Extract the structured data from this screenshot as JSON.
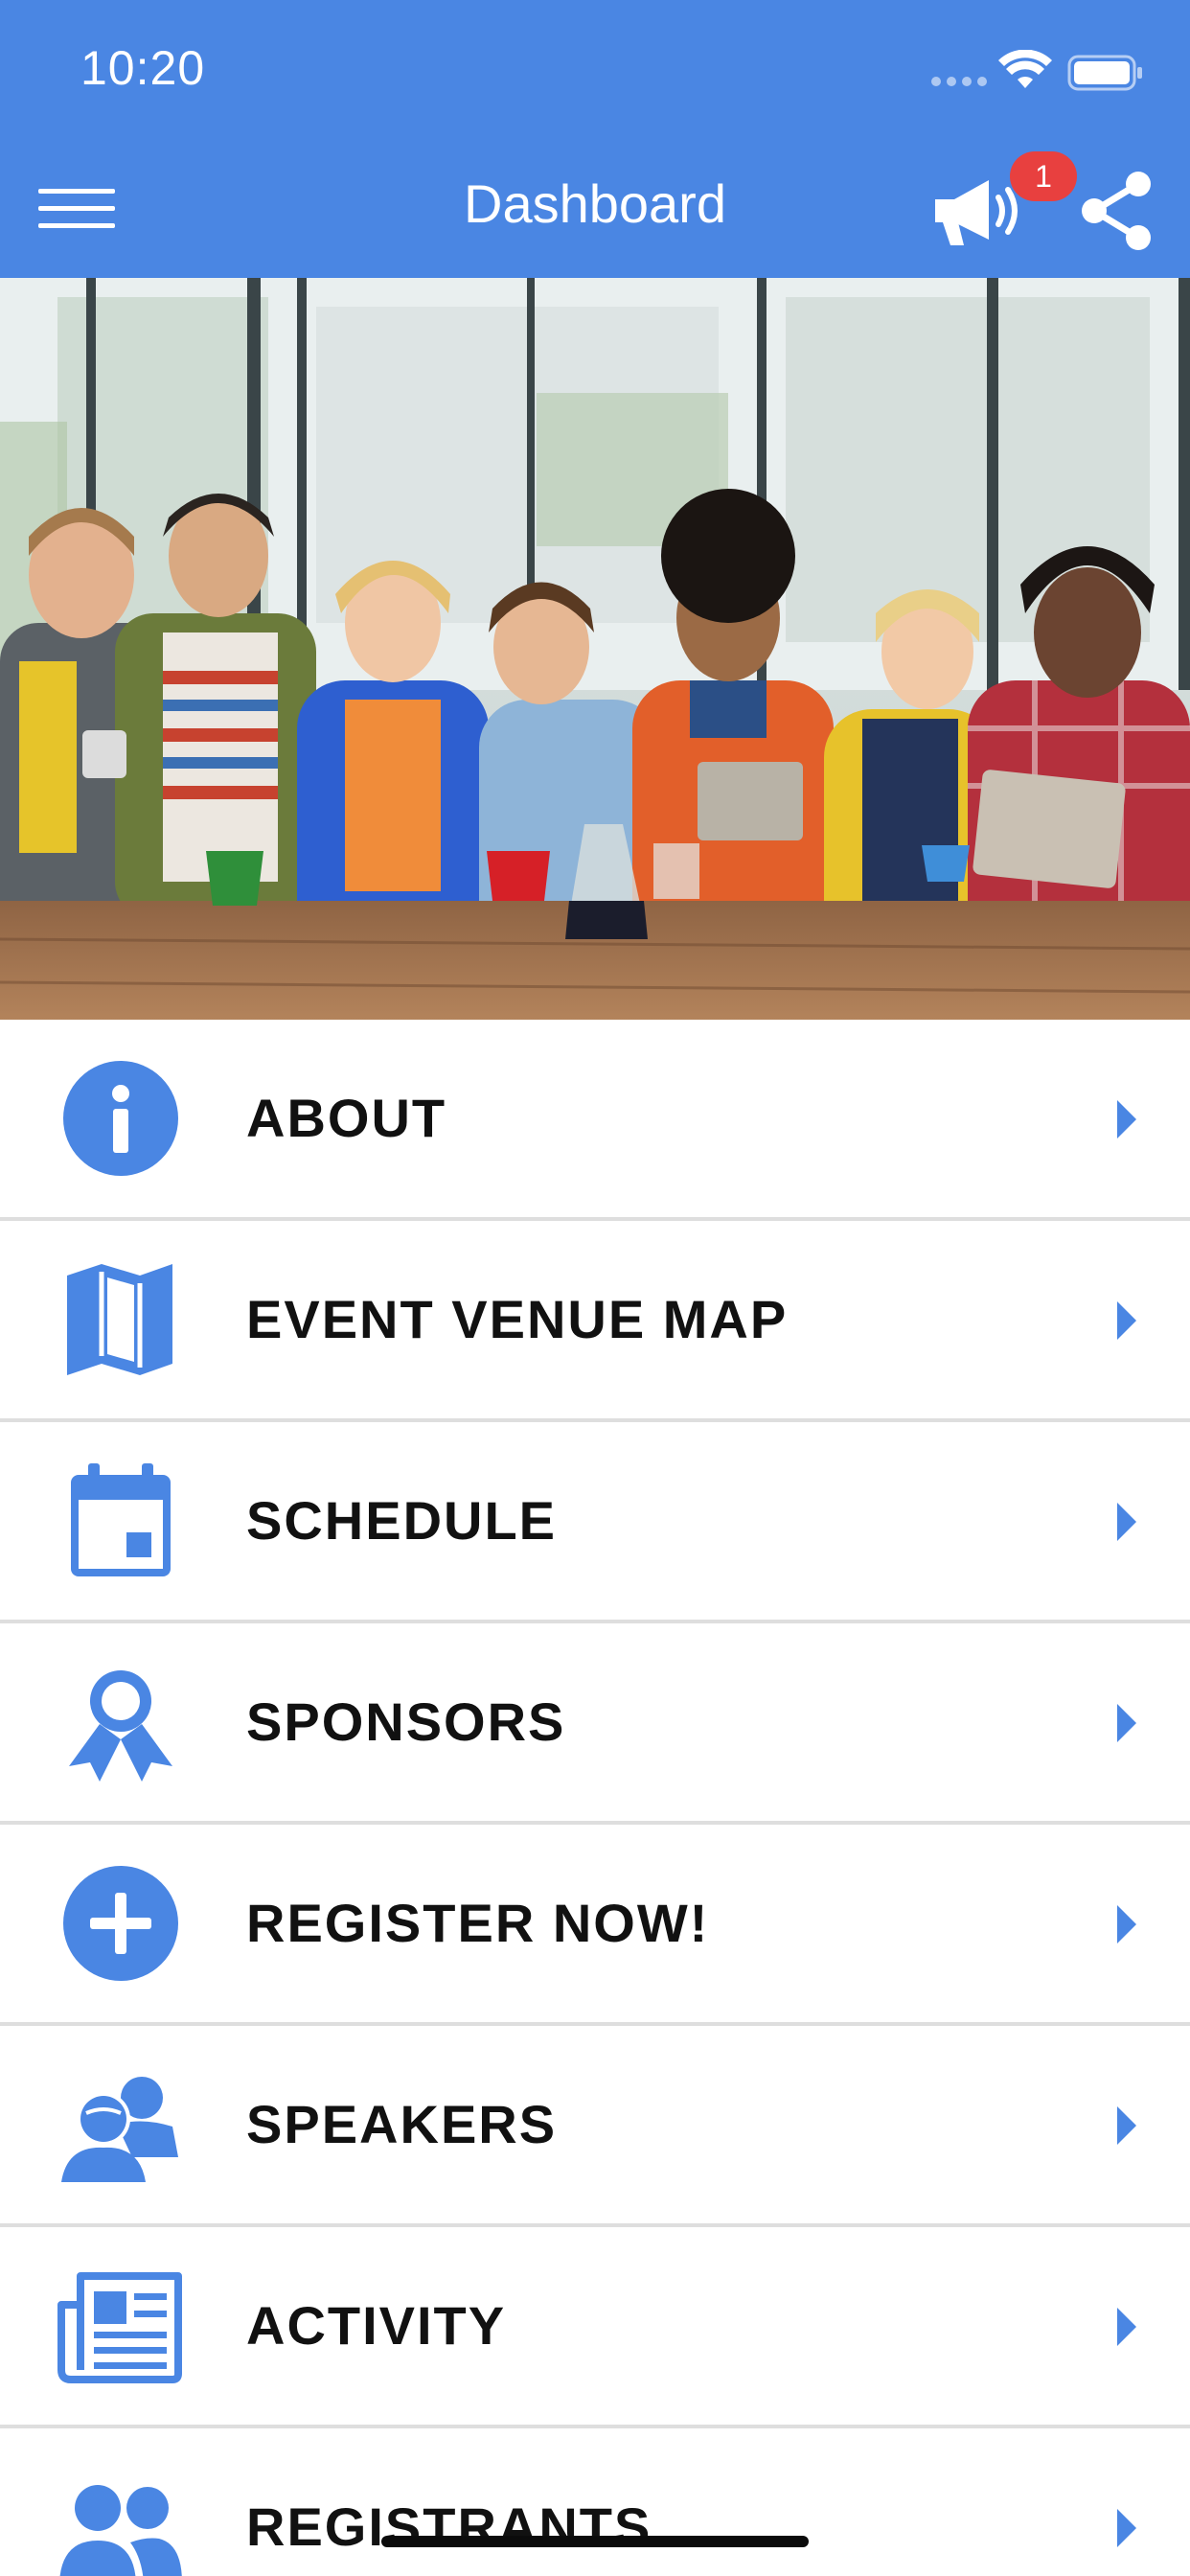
{
  "status_bar": {
    "time": "10:20"
  },
  "nav": {
    "title": "Dashboard",
    "notification_count": "1",
    "left_icon": "hamburger-menu-icon",
    "right_icons": [
      "megaphone-icon",
      "share-icon"
    ]
  },
  "colors": {
    "primary": "#4a86e3",
    "badge": "#e8403f",
    "text": "#111111",
    "divider": "#dedede"
  },
  "menu": {
    "items": [
      {
        "label": "ABOUT",
        "icon": "info-circle-icon"
      },
      {
        "label": "EVENT VENUE MAP",
        "icon": "map-icon"
      },
      {
        "label": "SCHEDULE",
        "icon": "calendar-icon"
      },
      {
        "label": "SPONSORS",
        "icon": "award-ribbon-icon"
      },
      {
        "label": "REGISTER NOW!",
        "icon": "plus-circle-icon"
      },
      {
        "label": "SPEAKERS",
        "icon": "speakers-icon"
      },
      {
        "label": "ACTIVITY",
        "icon": "newspaper-icon"
      },
      {
        "label": "REGISTRANTS",
        "icon": "group-icon"
      }
    ]
  }
}
